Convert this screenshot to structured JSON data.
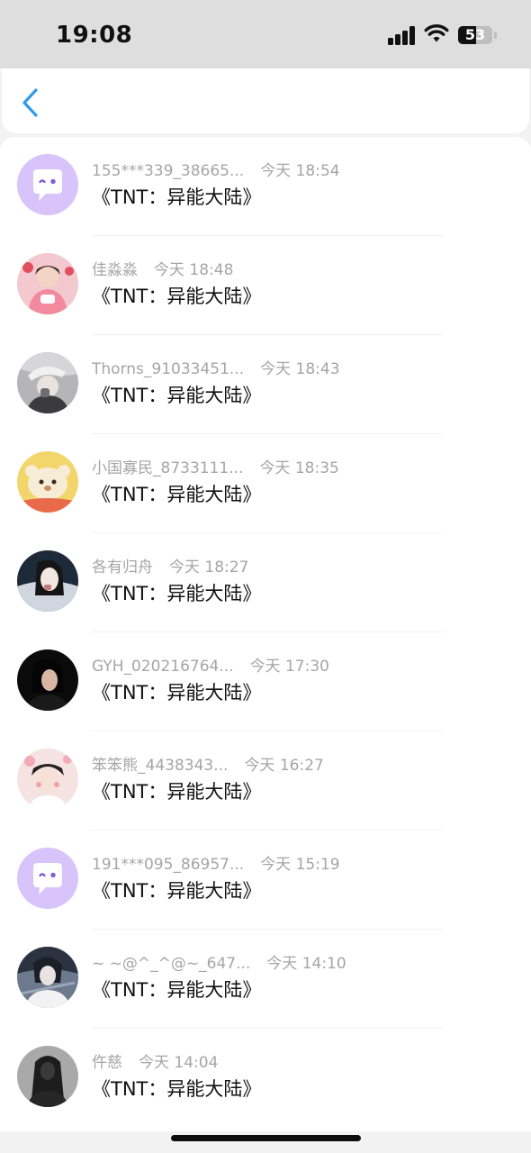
{
  "status_bar": {
    "time": "19:08",
    "battery_level": "53",
    "signal_bars": 4,
    "icons": [
      "signal-icon",
      "wifi-icon",
      "battery-icon"
    ]
  },
  "nav": {
    "back_icon": "chevron-left-icon"
  },
  "list": {
    "items": [
      {
        "name": "155***339_38665...",
        "time": "今天 18:54",
        "message": "《TNT：异能大陆》",
        "avatar": "default-chat-bubble-avatar"
      },
      {
        "name": "佳淼淼",
        "time": "今天 18:48",
        "message": "《TNT：异能大陆》",
        "avatar": "photo-avatar"
      },
      {
        "name": "Thorns_91033451...",
        "time": "今天 18:43",
        "message": "《TNT：异能大陆》",
        "avatar": "photo-avatar"
      },
      {
        "name": "小国寡民_8733111...",
        "time": "今天 18:35",
        "message": "《TNT：异能大陆》",
        "avatar": "photo-avatar"
      },
      {
        "name": "各有归舟",
        "time": "今天 18:27",
        "message": "《TNT：异能大陆》",
        "avatar": "photo-avatar"
      },
      {
        "name": "GYH_020216764...",
        "time": "今天 17:30",
        "message": "《TNT：异能大陆》",
        "avatar": "photo-avatar"
      },
      {
        "name": "笨笨熊_4438343...",
        "time": "今天 16:27",
        "message": "《TNT：异能大陆》",
        "avatar": "photo-avatar"
      },
      {
        "name": "191***095_86957...",
        "time": "今天 15:19",
        "message": "《TNT：异能大陆》",
        "avatar": "default-chat-bubble-avatar"
      },
      {
        "name": "~ ~@^_^@~_647...",
        "time": "今天 14:10",
        "message": "《TNT：异能大陆》",
        "avatar": "photo-avatar"
      },
      {
        "name": "仵慈",
        "time": "今天 14:04",
        "message": "《TNT：异能大陆》",
        "avatar": "photo-avatar"
      }
    ]
  },
  "colors": {
    "accent_blue": "#2f9bea",
    "default_avatar_bg": "#d8c3fb",
    "name_gray": "#a5a5a5",
    "message_black": "#111111"
  }
}
